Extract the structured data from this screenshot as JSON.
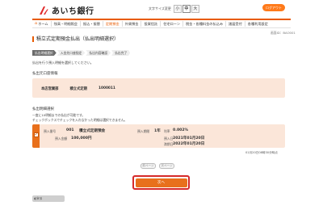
{
  "header": {
    "bank_name": "あいち銀行",
    "font_size_label": "文字サイズ変更",
    "font_sizes": [
      "小",
      "中",
      "大"
    ],
    "logout_label": "ログアウト"
  },
  "nav": {
    "items": [
      {
        "label": "ホーム",
        "icon": "home-icon"
      },
      {
        "label": "残高・明細照会"
      },
      {
        "label": "振込・振替"
      },
      {
        "label": "定期預金"
      },
      {
        "label": "外貨預金"
      },
      {
        "label": "投資信託"
      },
      {
        "label": "住宅ローン"
      },
      {
        "label": "税金・各種料金の払込み"
      },
      {
        "label": "諸届受付"
      },
      {
        "label": "各種利用設定"
      }
    ]
  },
  "screen_id": "画面ID：BAO001",
  "page_title": "積立式定期預金払出（払出明細選択）",
  "steps": [
    "払出明細選択",
    "入金先口座指定",
    "払出内容確認",
    "払出完了"
  ],
  "lead": "払出を行う預入明細を選択してください。",
  "section_account": {
    "heading": "払出元口座情報",
    "branch": "本店営業部",
    "type": "積立式定期",
    "number": "1000011"
  },
  "section_detail": {
    "heading": "払出明細選択",
    "notes": [
      "一度に10明細までの払出が可能です。",
      "チェックボックスでチェックを入れなかった明細は選択できません。"
    ]
  },
  "detail": {
    "deposit_no_label": "預入番号",
    "deposit_no": "001",
    "product": "積立式定期預金",
    "amount_label": "預入金額",
    "amount": "100,000円",
    "period_label": "預入期間",
    "period": "1年",
    "rate_label": "利率",
    "rate": "0.002%",
    "deposit_date_label": "預入日",
    "deposit_date": "2021年01月20日",
    "maturity_label": "満期日",
    "maturity_date": "2022年01月20日"
  },
  "summary": "01月20日08時30分時点",
  "pager": {
    "prev": "前ページ",
    "next": "次ページ"
  },
  "next_button": "次へ",
  "back_button": "戻る",
  "colors": {
    "accent": "#e8701c",
    "highlight": "#d62a2a",
    "panel": "#fbe6d9"
  }
}
